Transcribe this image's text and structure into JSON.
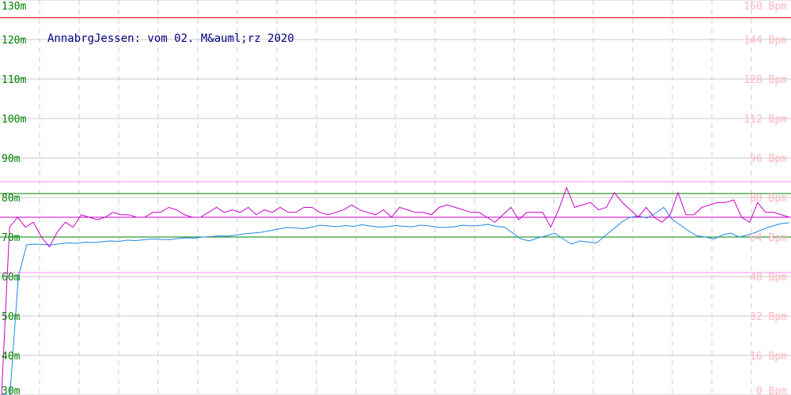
{
  "chart_data": {
    "type": "line",
    "title": "AnnabrgJessen: vom 02. M&auml;rz 2020",
    "y_left": {
      "ticks": [
        "130m",
        "120m",
        "110m",
        "100m",
        "90m",
        "80m",
        "70m",
        "60m",
        "50m",
        "40m",
        "30m"
      ],
      "ylim": [
        30,
        130
      ],
      "color": "#008000"
    },
    "y_right": {
      "ticks": [
        "160 Bpm",
        "144 Bpm",
        "128 Bpm",
        "112 Bpm",
        "96 Bpm",
        "80 Bpm",
        "64 Bpm",
        "48 Bpm",
        "32 Bpm",
        "16 Bpm",
        "0 Bpm"
      ],
      "ylim": [
        0,
        160
      ],
      "color": "#ffb6c1"
    },
    "grid": true,
    "reference_lines": [
      {
        "axis": "left",
        "value": 125.5,
        "color": "#dd0000"
      },
      {
        "axis": "left",
        "value": 81,
        "color": "#008000"
      },
      {
        "axis": "left",
        "value": 70,
        "color": "#008000"
      },
      {
        "axis": "right",
        "value": 86.4,
        "color": "#ff88ff"
      },
      {
        "axis": "right",
        "value": 72,
        "color": "#cc00cc"
      },
      {
        "axis": "right",
        "value": 49.6,
        "color": "#ff88ff"
      }
    ],
    "series": [
      {
        "axis": "left",
        "color": "#1e88e5",
        "values": [
          30,
          30,
          60,
          68,
          68.2,
          68.1,
          68,
          68.3,
          68.5,
          68.4,
          68.7,
          68.6,
          68.8,
          69,
          68.9,
          69.2,
          69.1,
          69.3,
          69.5,
          69.4,
          69.3,
          69.6,
          69.8,
          69.7,
          70,
          70.1,
          70.3,
          70.2,
          70.5,
          70.8,
          71,
          71.2,
          71.6,
          72,
          72.4,
          72.3,
          72.1,
          72.5,
          73,
          72.8,
          72.6,
          72.9,
          72.7,
          73.1,
          72.8,
          72.5,
          72.6,
          72.9,
          72.7,
          72.6,
          73,
          72.8,
          72.5,
          72.4,
          72.6,
          73,
          72.8,
          72.9,
          73.2,
          72.7,
          72.5,
          71,
          69.5,
          69,
          69.8,
          70.3,
          71,
          69.5,
          68.2,
          69,
          68.7,
          68.5,
          70.3,
          72,
          73.8,
          75,
          75.3,
          74.8,
          76,
          77.5,
          74.5,
          73,
          71.5,
          70.3,
          70,
          69.5,
          70.5,
          71,
          70,
          70.5,
          71.2,
          72.1,
          72.8,
          73.4,
          73.6
        ]
      },
      {
        "axis": "right",
        "color": "#cc00cc",
        "values": [
          0,
          68,
          72,
          68,
          70,
          64,
          60,
          66,
          70,
          68,
          73,
          72,
          71,
          72,
          74,
          73,
          73,
          72,
          72,
          74,
          74,
          76,
          75,
          73,
          72,
          72,
          74,
          76,
          74,
          75,
          74,
          76,
          73,
          75,
          74,
          76,
          74,
          74,
          76,
          76,
          74,
          73,
          74,
          75,
          77,
          75,
          74,
          73,
          75,
          72,
          76,
          75,
          74,
          74,
          73,
          76,
          77,
          76,
          75,
          74,
          74,
          72,
          70,
          73,
          76,
          71,
          74,
          74,
          74,
          68,
          75,
          84,
          76,
          77,
          78,
          75,
          76,
          82,
          78,
          75,
          72,
          76,
          72,
          70,
          73,
          82,
          73,
          73,
          76,
          77,
          78,
          78,
          79,
          72,
          70,
          78,
          74,
          74,
          73,
          72
        ]
      }
    ]
  }
}
